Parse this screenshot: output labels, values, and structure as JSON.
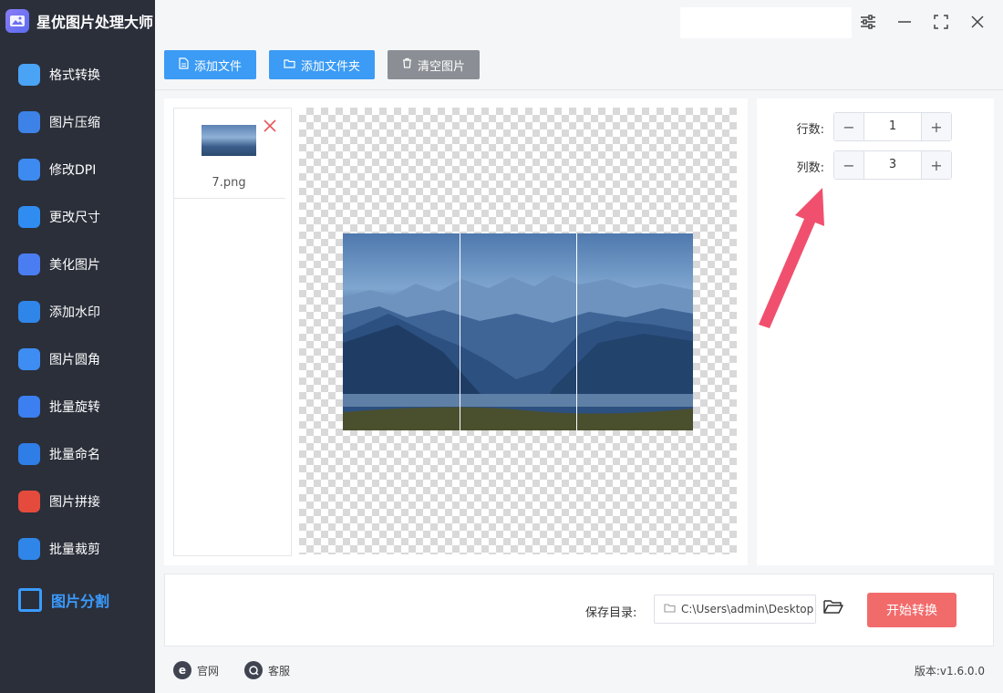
{
  "app": {
    "title": "星优图片处理大师"
  },
  "sidebar": {
    "items": [
      {
        "label": "格式转换",
        "icon": "image-convert-icon",
        "color": "#4aa3f5"
      },
      {
        "label": "图片压缩",
        "icon": "image-compress-icon",
        "color": "#3d82e6"
      },
      {
        "label": "修改DPI",
        "icon": "dpi-icon",
        "color": "#3d8af0"
      },
      {
        "label": "更改尺寸",
        "icon": "resize-icon",
        "color": "#2f8df2"
      },
      {
        "label": "美化图片",
        "icon": "beautify-icon",
        "color": "#4b7df2"
      },
      {
        "label": "添加水印",
        "icon": "watermark-icon",
        "color": "#2f86e8"
      },
      {
        "label": "图片圆角",
        "icon": "rounded-corner-icon",
        "color": "#3e8df2"
      },
      {
        "label": "批量旋转",
        "icon": "rotate-icon",
        "color": "#3b7ff0"
      },
      {
        "label": "批量命名",
        "icon": "rename-icon",
        "color": "#2f7de6"
      },
      {
        "label": "图片拼接",
        "icon": "stitch-icon",
        "color": "#e54b3c"
      },
      {
        "label": "批量裁剪",
        "icon": "crop-icon",
        "color": "#2f86e8"
      },
      {
        "label": "图片分割",
        "icon": "split-icon",
        "color": "#3a9cff",
        "active": true
      }
    ]
  },
  "toolbar": {
    "add_file": "添加文件",
    "add_folder": "添加文件夹",
    "clear_images": "清空图片"
  },
  "file_list": [
    {
      "name": "7.png"
    }
  ],
  "settings": {
    "rows_label": "行数:",
    "rows_value": "1",
    "cols_label": "列数:",
    "cols_value": "3"
  },
  "preview": {
    "columns": 3,
    "rows": 1
  },
  "output": {
    "save_label": "保存目录:",
    "path": "C:\\Users\\admin\\Desktop",
    "start_button": "开始转换"
  },
  "footer": {
    "website": "官网",
    "support": "客服",
    "version": "版本:v1.6.0.0"
  },
  "colors": {
    "sidebar_bg": "#2b2f3a",
    "primary": "#3b9bf5",
    "danger": "#f26b6b",
    "arrow": "#f0506e"
  }
}
